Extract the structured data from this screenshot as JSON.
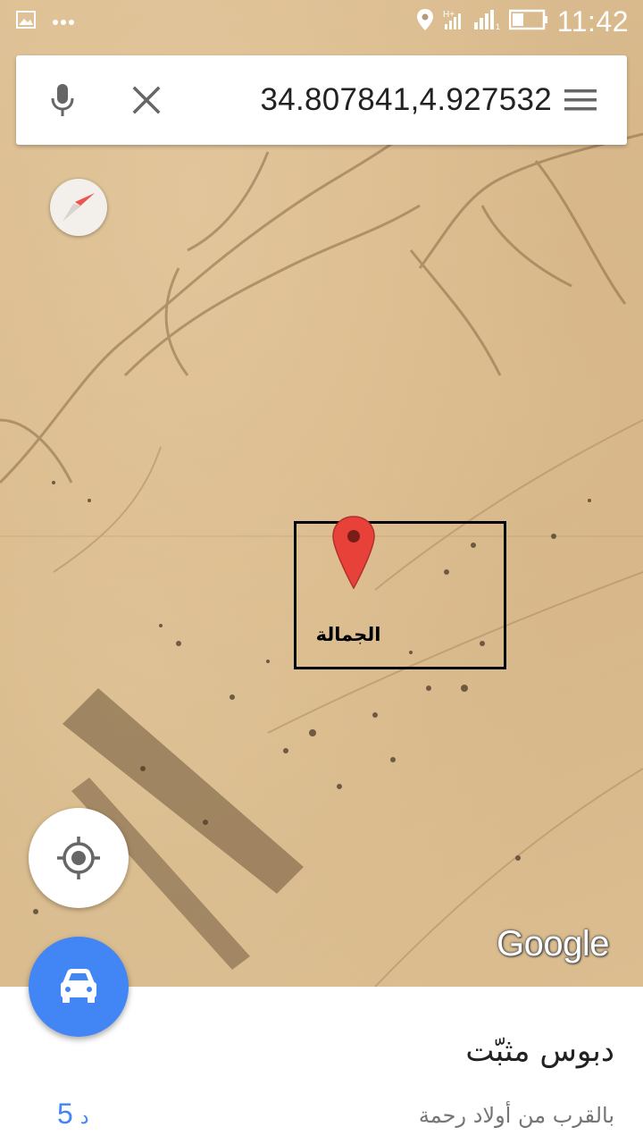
{
  "status_bar": {
    "time": "11:42",
    "icons": [
      "gallery-icon",
      "more-dots-icon",
      "location-icon",
      "hplus-signal-icon",
      "cell-signal-icon",
      "battery-icon"
    ],
    "color": "#ffffff"
  },
  "search": {
    "query": "34.807841,4.927532",
    "icons": [
      "mic-icon",
      "close-icon",
      "menu-icon"
    ]
  },
  "map": {
    "view": "satellite",
    "pin_label": "الجمالة",
    "pin_color": "#e8413a",
    "highlight_box_color": "#000000",
    "attribution": "Google"
  },
  "controls": {
    "compass": "compass-icon",
    "locate": "my-location-icon",
    "directions": "car-icon",
    "directions_color": "#4285f4"
  },
  "place_sheet": {
    "title": "دبوس مثبّت",
    "subtitle": "بالقرب من أولاد رحمة",
    "drive_time_value": "5",
    "drive_time_unit": "د",
    "accent": "#4285f4"
  }
}
